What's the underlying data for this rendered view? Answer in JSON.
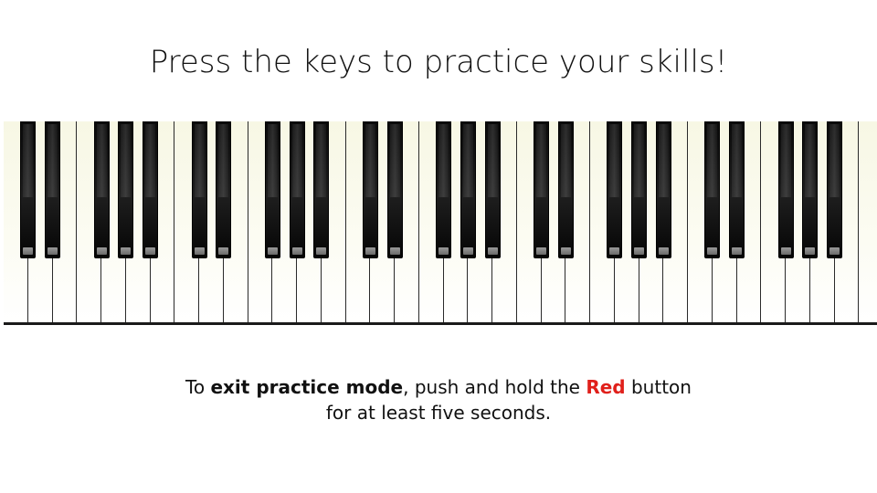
{
  "title": "Press the keys to practice your skills!",
  "keyboard": {
    "white_key_count": 36,
    "black_key_pattern": [
      "C#",
      "D#",
      "F#",
      "G#",
      "A#"
    ]
  },
  "instructions": {
    "line1_prefix": "To ",
    "line1_bold": "exit practice mode",
    "line1_middle": ", push and hold the ",
    "line1_red": "Red",
    "line1_suffix": " button",
    "line2": "for at least five seconds.",
    "red_color": "#e0201b"
  }
}
